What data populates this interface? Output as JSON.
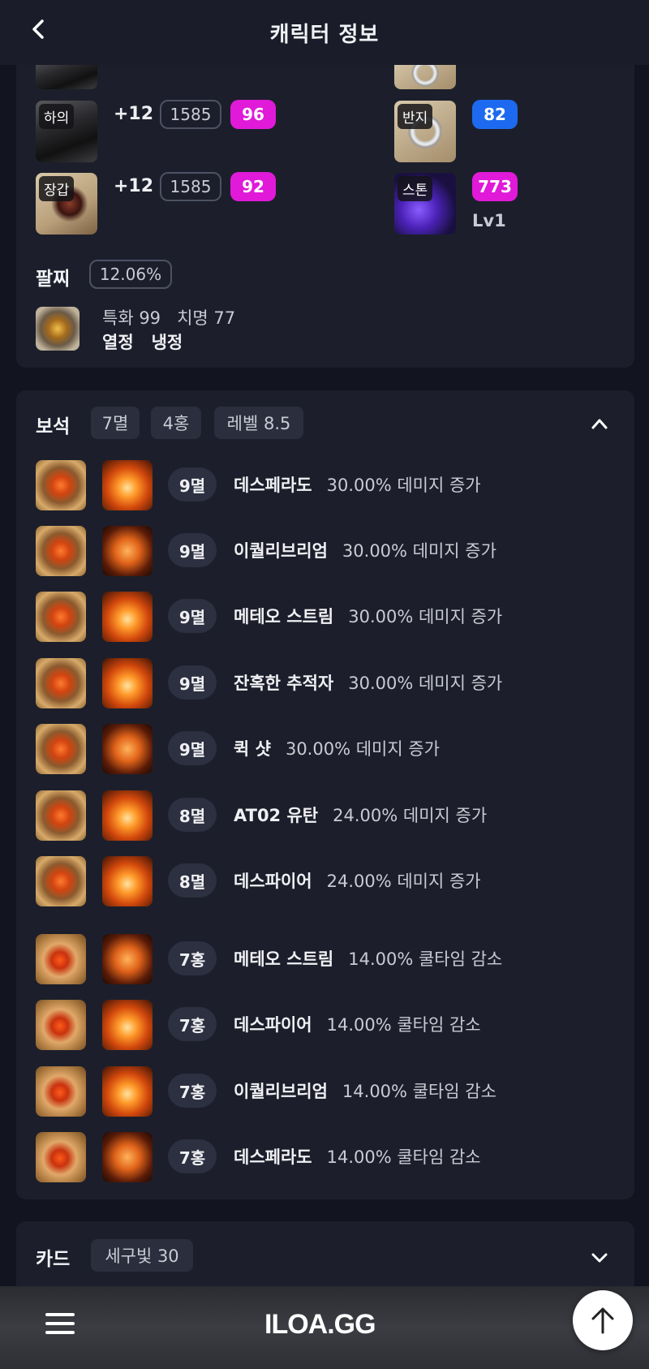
{
  "header": {
    "title": "캐릭터 정보"
  },
  "equipment": [
    {
      "slot": "하의",
      "enhance": "+12",
      "item_level": "1585",
      "quality": "96"
    },
    {
      "slot": "장갑",
      "enhance": "+12",
      "item_level": "1585",
      "quality": "92"
    }
  ],
  "accessories": [
    {
      "slot": "반지",
      "quality": "82"
    },
    {
      "slot": "스톤",
      "quality": "773",
      "level": "Lv1"
    }
  ],
  "bracelet": {
    "title": "팔찌",
    "percent": "12.06%",
    "stats": "특화 99   치명 77",
    "effects": "열정   냉정"
  },
  "gems": {
    "title": "보석",
    "chips": [
      "7멸",
      "4홍",
      "레벨 8.5"
    ],
    "items": [
      {
        "level": "9멸",
        "skill": "데스페라도",
        "effect": "30.00% 데미지 증가",
        "type": "멸"
      },
      {
        "level": "9멸",
        "skill": "이퀄리브리엄",
        "effect": "30.00% 데미지 증가",
        "type": "멸"
      },
      {
        "level": "9멸",
        "skill": "메테오 스트림",
        "effect": "30.00% 데미지 증가",
        "type": "멸"
      },
      {
        "level": "9멸",
        "skill": "잔혹한 추적자",
        "effect": "30.00% 데미지 증가",
        "type": "멸"
      },
      {
        "level": "9멸",
        "skill": "퀵 샷",
        "effect": "30.00% 데미지 증가",
        "type": "멸"
      },
      {
        "level": "8멸",
        "skill": "AT02 유탄",
        "effect": "24.00% 데미지 증가",
        "type": "멸"
      },
      {
        "level": "8멸",
        "skill": "데스파이어",
        "effect": "24.00% 데미지 증가",
        "type": "멸"
      },
      {
        "level": "7홍",
        "skill": "메테오 스트림",
        "effect": "14.00% 쿨타임 감소",
        "type": "홍"
      },
      {
        "level": "7홍",
        "skill": "데스파이어",
        "effect": "14.00% 쿨타임 감소",
        "type": "홍"
      },
      {
        "level": "7홍",
        "skill": "이퀄리브리엄",
        "effect": "14.00% 쿨타임 감소",
        "type": "홍"
      },
      {
        "level": "7홍",
        "skill": "데스페라도",
        "effect": "14.00% 쿨타임 감소",
        "type": "홍"
      }
    ]
  },
  "cards": {
    "title": "카드",
    "chip": "세구빛 30"
  },
  "footer": {
    "logo": "ILOA.GG"
  }
}
